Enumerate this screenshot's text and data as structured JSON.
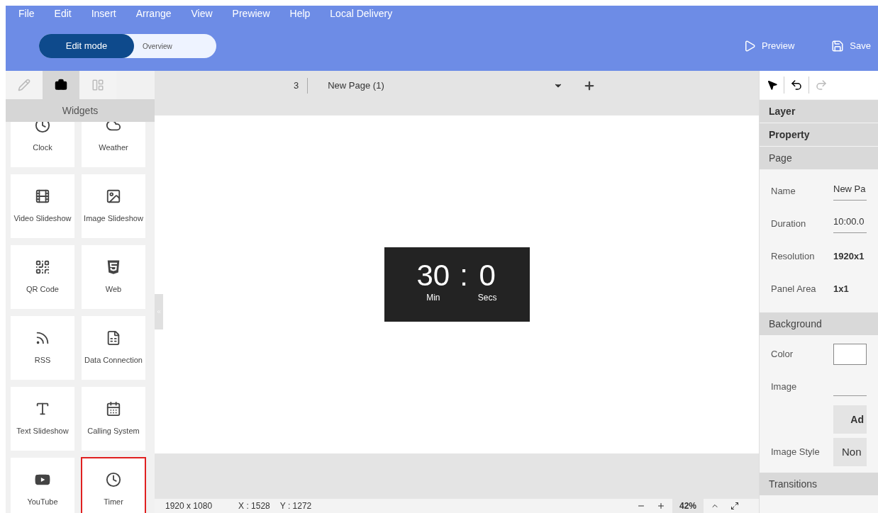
{
  "menu": [
    "File",
    "Edit",
    "Insert",
    "Arrange",
    "View",
    "Prewiew",
    "Help",
    "Local Delivery"
  ],
  "modes": [
    {
      "label": "Edit mode",
      "selected": true
    },
    {
      "label": "Overview",
      "selected": false
    }
  ],
  "actions": [
    {
      "kind": "preview",
      "label": "Preview"
    },
    {
      "kind": "save",
      "label": "Save"
    }
  ],
  "left_tabs": [
    {
      "kind": "pen",
      "selected": false
    },
    {
      "kind": "briefcase",
      "selected": true
    },
    {
      "kind": "layout",
      "selected": false
    }
  ],
  "widgets_title": "Widgets",
  "widgets": [
    {
      "kind": "clock",
      "label": "Clock",
      "selected": false
    },
    {
      "kind": "weather",
      "label": "Weather",
      "selected": false
    },
    {
      "kind": "video",
      "label": "Video Slideshow",
      "selected": false
    },
    {
      "kind": "image",
      "label": "Image Slideshow",
      "selected": false
    },
    {
      "kind": "qr",
      "label": "QR Code",
      "selected": false
    },
    {
      "kind": "web",
      "label": "Web",
      "selected": false
    },
    {
      "kind": "rss",
      "label": "RSS",
      "selected": false
    },
    {
      "kind": "data",
      "label": "Data Connection",
      "selected": false
    },
    {
      "kind": "text",
      "label": "Text Slideshow",
      "selected": false
    },
    {
      "kind": "calling",
      "label": "Calling System",
      "selected": false
    },
    {
      "kind": "youtube",
      "label": "YouTube",
      "selected": false
    },
    {
      "kind": "timer",
      "label": "Timer",
      "selected": true
    }
  ],
  "page_bar": {
    "number": "3",
    "page": "New Page (1)"
  },
  "timer": {
    "minutes": "30",
    "separator": ":",
    "seconds": "0",
    "min_label": "Min",
    "sec_label": "Secs"
  },
  "status_bar": {
    "resolution": "1920 x 1080",
    "x": "X : 1528",
    "y": "Y : 1272",
    "zoom": "42%"
  },
  "right_panel": {
    "sections": [
      "Layer",
      "Property"
    ],
    "page_title": "Page",
    "page_fields": [
      {
        "kind": "input",
        "label": "Name",
        "value": "New Pa"
      },
      {
        "kind": "input",
        "label": "Duration",
        "value": "10:00.0"
      },
      {
        "kind": "text",
        "label": "Resolution",
        "value": "1920x1"
      },
      {
        "kind": "text",
        "label": "Panel Area",
        "value": "1x1"
      }
    ],
    "background_title": "Background",
    "background_fields": [
      {
        "kind": "color",
        "label": "Color"
      },
      {
        "kind": "input",
        "label": "Image"
      },
      {
        "kind": "button",
        "value": "Ad"
      },
      {
        "kind": "select",
        "label": "Image Style",
        "value": "Non"
      }
    ],
    "transitions_title": "Transitions"
  }
}
